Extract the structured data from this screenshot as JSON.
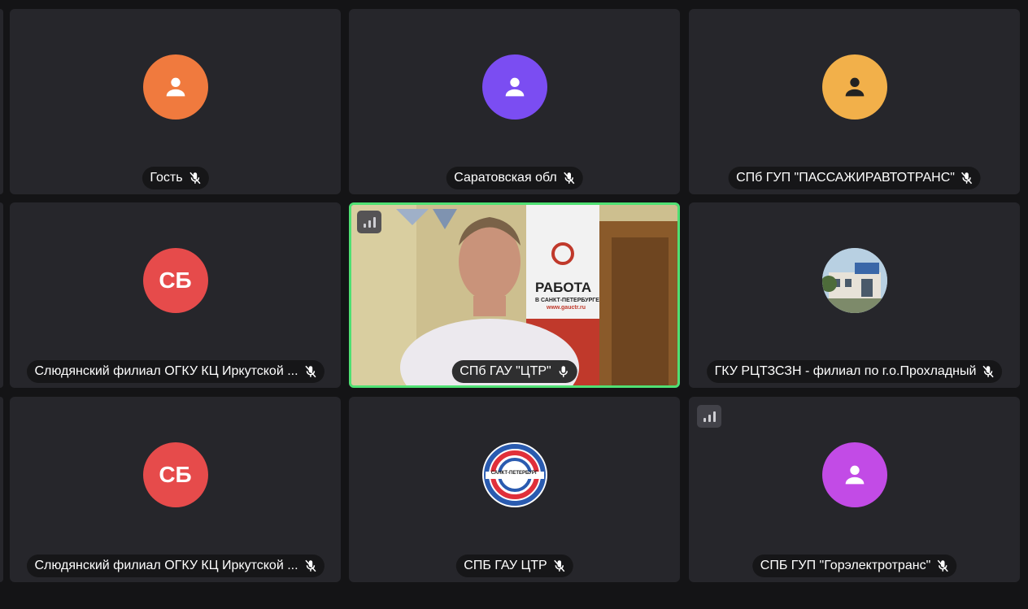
{
  "participants": [
    {
      "name": "Гость",
      "avatar_color": "#f07a3e",
      "icon": "user-icon",
      "muted": true
    },
    {
      "name": "Саратовская обл",
      "avatar_color": "#7b4df2",
      "icon": "user-icon",
      "muted": true
    },
    {
      "name": "СПб ГУП \"ПАССАЖИРАВТОТРАНС\"",
      "avatar_color": "#f2b04a",
      "icon": "user-icon",
      "muted": true
    },
    {
      "name": "Слюдянский филиал ОГКУ КЦ Иркутской ...",
      "initials": "СБ",
      "avatar_color": "#e64b4b",
      "muted": true
    },
    {
      "name": "СПб ГАУ \"ЦТР\"",
      "icon": "video-feed",
      "muted": false,
      "speaking": true,
      "banner": {
        "title": "РАБОТА",
        "subtitle": "В САНКТ-ПЕТЕРБУРГЕ",
        "url": "www.gauctr.ru"
      }
    },
    {
      "name": "ГКУ РЦТЗСЗН - филиал по г.о.Прохладный",
      "icon": "building-photo",
      "muted": true
    },
    {
      "name": "Слюдянский филиал ОГКУ КЦ Иркутской ...",
      "initials": "СБ",
      "avatar_color": "#e64b4b",
      "muted": true
    },
    {
      "name": "СПБ ГАУ ЦТР",
      "logo_text": "САНКТ-ПЕТЕРБУРГ",
      "muted": true
    },
    {
      "name": "СПБ ГУП \"Горэлектротранс\"",
      "avatar_color": "#c24be6",
      "icon": "user-icon",
      "muted": true
    }
  ]
}
